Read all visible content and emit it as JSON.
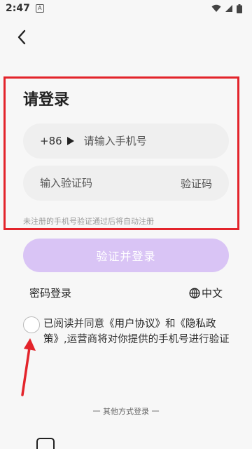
{
  "status_bar": {
    "time": "2:47",
    "notification_icon": "a-icon",
    "wifi_icon": "wifi-icon",
    "signal_icon": "signal-icon",
    "battery_icon": "battery-icon"
  },
  "header": {
    "back_icon": "back-arrow-icon",
    "title": "请登录"
  },
  "phone_field": {
    "country_code": "+86",
    "dropdown_icon": "play-icon",
    "placeholder": "请输入手机号"
  },
  "code_field": {
    "placeholder": "输入验证码",
    "get_code_label": "验证码"
  },
  "hint": "未注册的手机号验证通过后将自动注册",
  "login_button": "验证并登录",
  "password_login": "密码登录",
  "language": {
    "icon": "globe-icon",
    "label": "中文"
  },
  "agreement": {
    "prefix": "已阅读并同意",
    "user_agreement": "《用户协议》",
    "and": "和",
    "privacy_policy": "《隐私政策》",
    "suffix": ",运营商将对你提供的手机号进行验证"
  },
  "other_login": "一 其他方式登录 一",
  "colors": {
    "accent": "#d9c4f5",
    "annotation_red": "#e3242b",
    "background": "#f7f7f7"
  }
}
